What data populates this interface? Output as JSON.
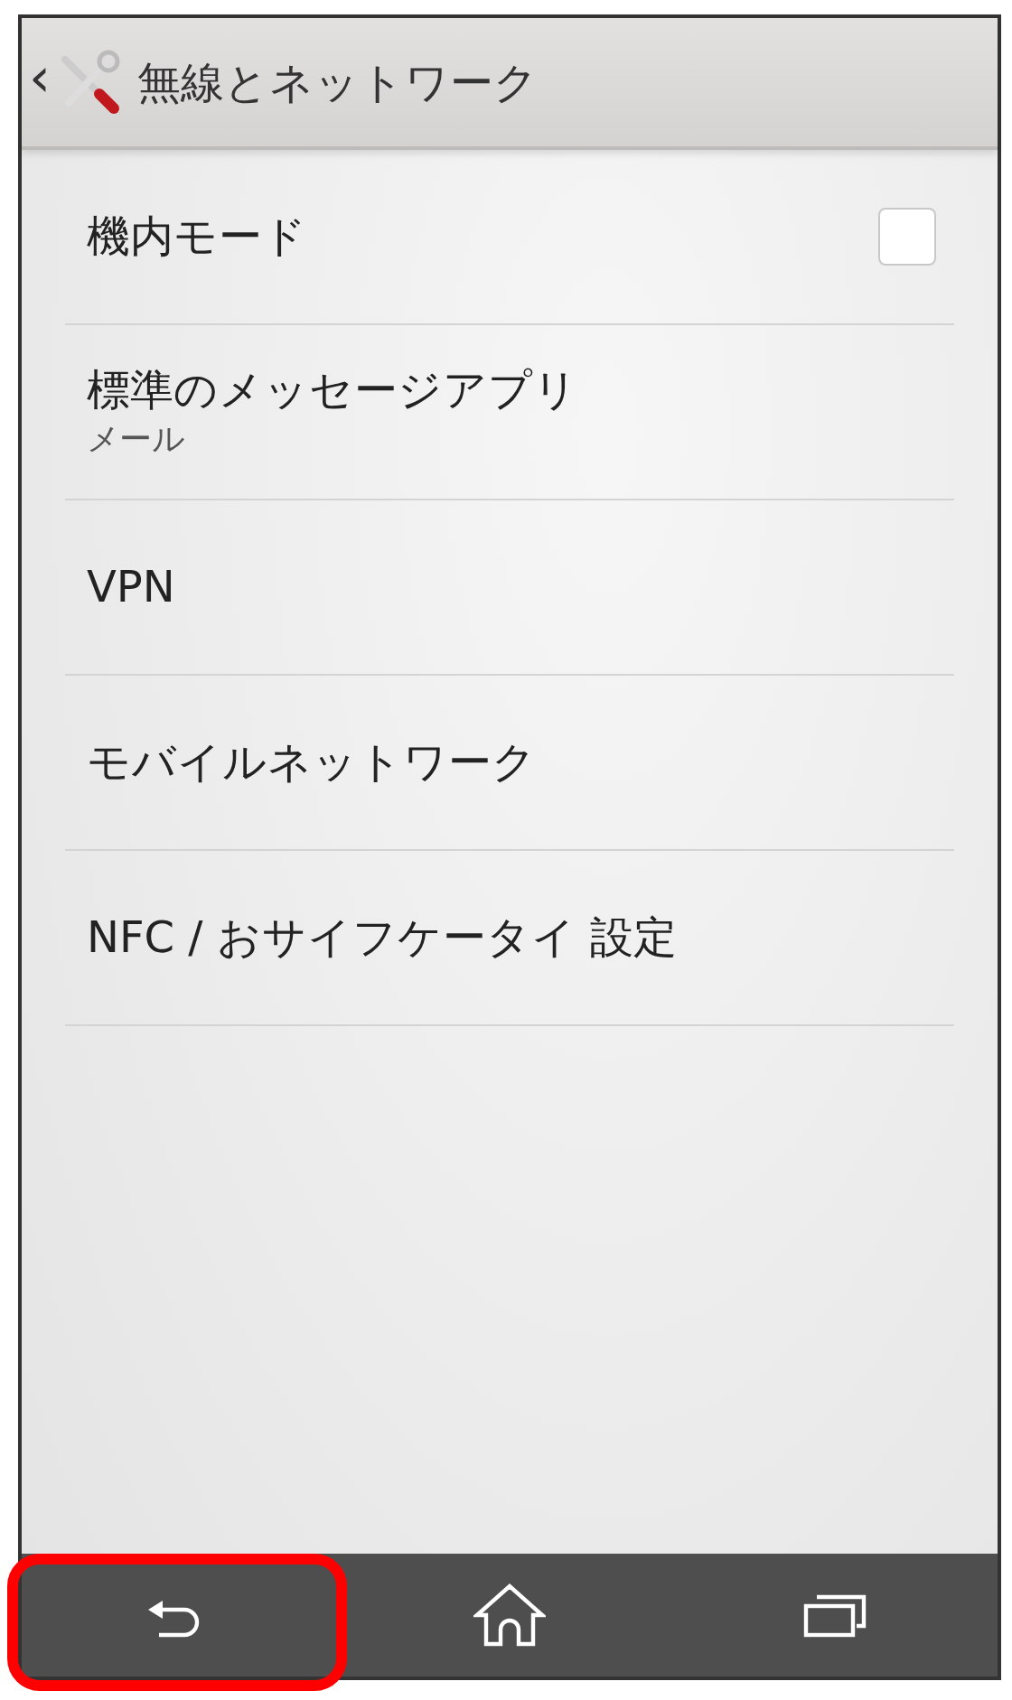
{
  "header": {
    "back": "‹",
    "title": "無線とネットワーク"
  },
  "items": [
    {
      "kind": "checkbox",
      "title": "機内モード",
      "checked": false
    },
    {
      "kind": "summary",
      "title": "標準のメッセージアプリ",
      "summary": "メール"
    },
    {
      "kind": "plain",
      "title": "VPN"
    },
    {
      "kind": "plain",
      "title": "モバイルネットワーク"
    },
    {
      "kind": "plain",
      "title": "NFC / おサイフケータイ 設定"
    }
  ],
  "nav_buttons": [
    {
      "kind": "back",
      "highlighted": true
    },
    {
      "kind": "home",
      "highlighted": false
    },
    {
      "kind": "recent",
      "highlighted": false
    }
  ]
}
